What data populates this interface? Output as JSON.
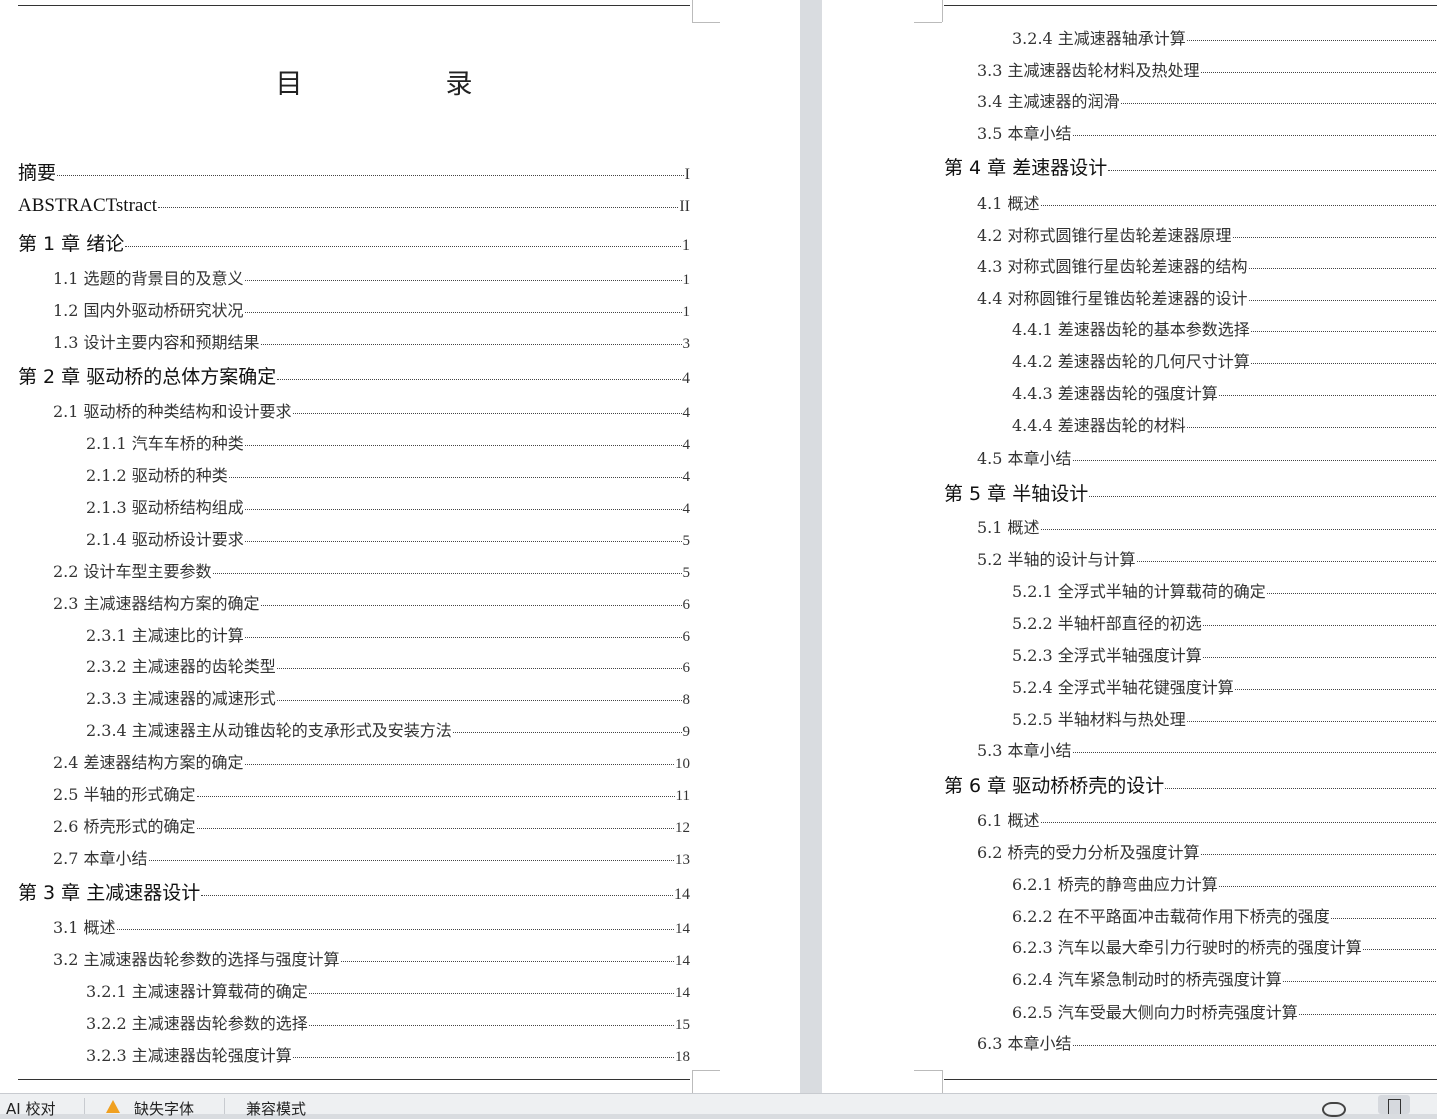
{
  "document": {
    "toc_title": "目　录",
    "page1_entries": [
      {
        "level": "top",
        "text": "摘要",
        "page": "I"
      },
      {
        "level": "top",
        "text": "ABSTRACTstract",
        "page": "II"
      },
      {
        "level": "ch",
        "text": "第 1 章  绪论",
        "page": "1"
      },
      {
        "level": "s1",
        "text": "1.1  选题的背景目的及意义",
        "page": "1"
      },
      {
        "level": "s1",
        "text": "1.2  国内外驱动桥研究状况",
        "page": "1"
      },
      {
        "level": "s1",
        "text": "1.3  设计主要内容和预期结果",
        "page": "3"
      },
      {
        "level": "ch",
        "text": "第 2 章  驱动桥的总体方案确定",
        "page": "4"
      },
      {
        "level": "s1",
        "text": "2.1 驱动桥的种类结构和设计要求",
        "page": "4"
      },
      {
        "level": "s2",
        "text": "2.1.1 汽车车桥的种类",
        "page": "4"
      },
      {
        "level": "s2",
        "text": "2.1.2 驱动桥的种类",
        "page": "4"
      },
      {
        "level": "s2",
        "text": "2.1.3 驱动桥结构组成",
        "page": "4"
      },
      {
        "level": "s2",
        "text": "2.1.4  驱动桥设计要求",
        "page": "5"
      },
      {
        "level": "s1",
        "text": "2.2  设计车型主要参数",
        "page": "5"
      },
      {
        "level": "s1",
        "text": "2.3 主减速器结构方案的确定",
        "page": "6"
      },
      {
        "level": "s2",
        "text": "2.3.1  主减速比的计算",
        "page": "6"
      },
      {
        "level": "s2",
        "text": "2.3.2  主减速器的齿轮类型",
        "page": "6"
      },
      {
        "level": "s2",
        "text": "2.3.3  主减速器的减速形式",
        "page": "8"
      },
      {
        "level": "s2",
        "text": "2.3.4  主减速器主从动锥齿轮的支承形式及安装方法",
        "page": "9"
      },
      {
        "level": "s1",
        "text": "2.4  差速器结构方案的确定",
        "page": "10"
      },
      {
        "level": "s1",
        "text": "2.5 半轴的形式确定",
        "page": "11"
      },
      {
        "level": "s1",
        "text": "2.6  桥壳形式的确定",
        "page": "12"
      },
      {
        "level": "s1",
        "text": "2.7 本章小结",
        "page": "13"
      },
      {
        "level": "ch",
        "text": "第 3 章  主减速器设计",
        "page": "14"
      },
      {
        "level": "s1",
        "text": "3.1 概述",
        "page": "14"
      },
      {
        "level": "s1",
        "text": "3.2 主减速器齿轮参数的选择与强度计算",
        "page": "14"
      },
      {
        "level": "s2",
        "text": "3.2.1  主减速器计算载荷的确定",
        "page": "14"
      },
      {
        "level": "s2",
        "text": "3.2.2  主减速器齿轮参数的选择",
        "page": "15"
      },
      {
        "level": "s2",
        "text": "3.2.3  主减速器齿轮强度计算",
        "page": "18"
      }
    ],
    "page2_entries": [
      {
        "level": "s2",
        "text": "3.2.4  主减速器轴承计算",
        "page": ""
      },
      {
        "level": "s1",
        "text": "3.3 主减速器齿轮材料及热处理",
        "page": ""
      },
      {
        "level": "s1",
        "text": "3.4 主减速器的润滑",
        "page": ""
      },
      {
        "level": "s1",
        "text": "3.5  本章小结",
        "page": ""
      },
      {
        "level": "ch",
        "text": "第 4 章  差速器设计",
        "page": ""
      },
      {
        "level": "s1",
        "text": "4.1 概述",
        "page": ""
      },
      {
        "level": "s1",
        "text": "4.2 对称式圆锥行星齿轮差速器原理",
        "page": ""
      },
      {
        "level": "s1",
        "text": "4.3  对称式圆锥行星齿轮差速器的结构",
        "page": ""
      },
      {
        "level": "s1",
        "text": "4.4 对称圆锥行星锥齿轮差速器的设计",
        "page": ""
      },
      {
        "level": "s2",
        "text": "4.4.1  差速器齿轮的基本参数选择",
        "page": ""
      },
      {
        "level": "s2",
        "text": "4.4.2  差速器齿轮的几何尺寸计算",
        "page": ""
      },
      {
        "level": "s2",
        "text": "4.4.3  差速器齿轮的强度计算",
        "page": ""
      },
      {
        "level": "s2",
        "text": "4.4.4  差速器齿轮的材料",
        "page": ""
      },
      {
        "level": "s1",
        "text": "4.5  本章小结",
        "page": ""
      },
      {
        "level": "ch",
        "text": "第 5 章  半轴设计",
        "page": ""
      },
      {
        "level": "s1",
        "text": "5.1 概述",
        "page": ""
      },
      {
        "level": "s1",
        "text": "5.2 半轴的设计与计算",
        "page": ""
      },
      {
        "level": "s2",
        "text": "5.2.1 全浮式半轴的计算载荷的确定",
        "page": ""
      },
      {
        "level": "s2",
        "text": "5.2.2 半轴杆部直径的初选",
        "page": ""
      },
      {
        "level": "s2",
        "text": "5.2.3  全浮式半轴强度计算",
        "page": ""
      },
      {
        "level": "s2",
        "text": "5.2.4  全浮式半轴花键强度计算",
        "page": ""
      },
      {
        "level": "s2",
        "text": "5.2.5  半轴材料与热处理",
        "page": ""
      },
      {
        "level": "s1",
        "text": "5.3  本章小结",
        "page": ""
      },
      {
        "level": "ch",
        "text": "第 6 章  驱动桥桥壳的设计",
        "page": ""
      },
      {
        "level": "s1",
        "text": "6.1 概述",
        "page": ""
      },
      {
        "level": "s1",
        "text": "6.2 桥壳的受力分析及强度计算",
        "page": ""
      },
      {
        "level": "s2",
        "text": "6.2.1  桥壳的静弯曲应力计算",
        "page": ""
      },
      {
        "level": "s2",
        "text": "6.2.2  在不平路面冲击载荷作用下桥壳的强度",
        "page": ""
      },
      {
        "level": "s2",
        "text": "6.2.3  汽车以最大牵引力行驶时的桥壳的强度计算",
        "page": ""
      },
      {
        "level": "s2",
        "text": "6.2.4  汽车紧急制动时的桥壳强度计算",
        "page": ""
      },
      {
        "level": "s2",
        "text": "6.2.5  汽车受最大侧向力时桥壳强度计算",
        "page": ""
      },
      {
        "level": "s1",
        "text": "6.3  本章小结",
        "page": ""
      }
    ]
  },
  "statusbar": {
    "ai_check": "AI 校对",
    "missing_font": "缺失字体",
    "compat_mode": "兼容模式"
  }
}
